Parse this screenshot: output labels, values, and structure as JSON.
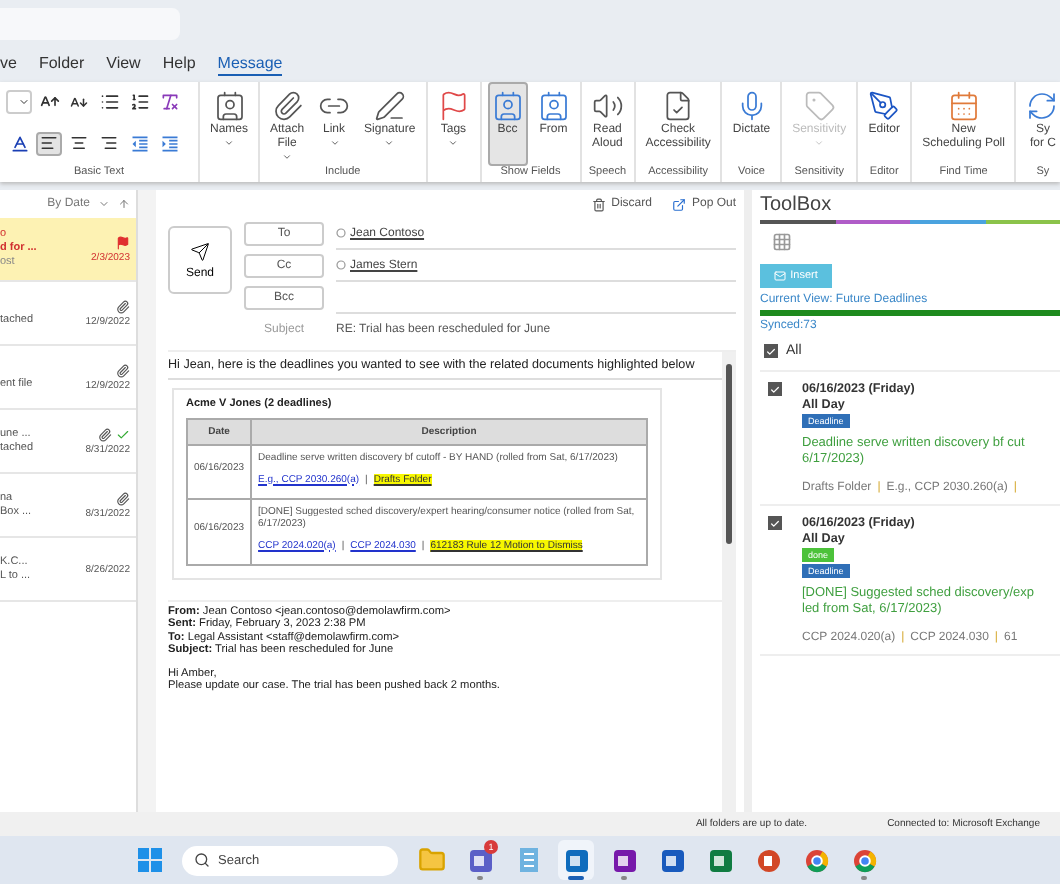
{
  "menu_tabs": [
    {
      "label": "ve",
      "selected": false
    },
    {
      "label": "Folder",
      "selected": false
    },
    {
      "label": "View",
      "selected": false
    },
    {
      "label": "Help",
      "selected": false
    },
    {
      "label": "Message",
      "selected": true
    }
  ],
  "ribbon": {
    "basic_text": {
      "label": "Basic Text",
      "alignment": [
        {
          "selected": true
        },
        {
          "selected": false
        },
        {
          "selected": false
        }
      ]
    },
    "groups": [
      {
        "items": [
          {
            "lines": [
              "Names"
            ],
            "dropdown": true,
            "selected": false,
            "disabled": false
          }
        ]
      },
      {
        "label": "Include",
        "items": [
          {
            "lines": [
              "Attach",
              "File"
            ],
            "dropdown": true,
            "selected": false,
            "disabled": false
          },
          {
            "lines": [
              "Link"
            ],
            "dropdown": true,
            "selected": false,
            "disabled": false
          },
          {
            "lines": [
              "Signature"
            ],
            "dropdown": true,
            "selected": false,
            "disabled": false
          }
        ]
      },
      {
        "items": [
          {
            "lines": [
              "Tags"
            ],
            "dropdown": true,
            "selected": false,
            "disabled": false
          }
        ]
      },
      {
        "label": "Show Fields",
        "items": [
          {
            "lines": [
              "Bcc"
            ],
            "dropdown": false,
            "selected": true,
            "disabled": false
          },
          {
            "lines": [
              "From"
            ],
            "dropdown": false,
            "selected": false,
            "disabled": false
          }
        ]
      },
      {
        "label": "Speech",
        "items": [
          {
            "lines": [
              "Read",
              "Aloud"
            ],
            "dropdown": false,
            "selected": false,
            "disabled": false
          }
        ]
      },
      {
        "label": "Accessibility",
        "items": [
          {
            "lines": [
              "Check",
              "Accessibility"
            ],
            "dropdown": false,
            "selected": false,
            "disabled": false
          }
        ]
      },
      {
        "label": "Voice",
        "items": [
          {
            "lines": [
              "Dictate"
            ],
            "dropdown": false,
            "selected": false,
            "disabled": false
          }
        ]
      },
      {
        "label": "Sensitivity",
        "items": [
          {
            "lines": [
              "Sensitivity"
            ],
            "dropdown": true,
            "selected": false,
            "disabled": true
          }
        ]
      },
      {
        "label": "Editor",
        "items": [
          {
            "lines": [
              "Editor"
            ],
            "dropdown": false,
            "selected": false,
            "disabled": false
          }
        ]
      },
      {
        "label": "Find Time",
        "items": [
          {
            "lines": [
              "New",
              "Scheduling Poll"
            ],
            "dropdown": false,
            "selected": false,
            "disabled": false
          }
        ]
      },
      {
        "label": "Sy",
        "items": [
          {
            "lines": [
              "Sy",
              "for C"
            ],
            "dropdown": false,
            "selected": false,
            "disabled": false
          }
        ]
      }
    ]
  },
  "message_list": {
    "sort": "By Date",
    "items": [
      {
        "lines": [
          "o",
          "d for ...",
          "ost"
        ],
        "date": "2/3/2023",
        "flagged": true,
        "attachment": false,
        "done": false
      },
      {
        "lines": [
          "tached"
        ],
        "date": "12/9/2022",
        "flagged": false,
        "attachment": true,
        "done": false
      },
      {
        "lines": [
          "ent file"
        ],
        "date": "12/9/2022",
        "flagged": false,
        "attachment": true,
        "done": false
      },
      {
        "lines": [
          "une ...",
          "tached"
        ],
        "date": "8/31/2022",
        "flagged": false,
        "attachment": true,
        "done": true
      },
      {
        "lines": [
          "na",
          "Box ..."
        ],
        "date": "8/31/2022",
        "flagged": false,
        "attachment": true,
        "done": false
      },
      {
        "lines": [
          "K.C...",
          "L to ..."
        ],
        "date": "8/26/2022",
        "flagged": false,
        "attachment": false,
        "done": false
      }
    ]
  },
  "compose": {
    "actions": [
      "Discard",
      "Pop Out"
    ],
    "send": "Send",
    "recipients": [
      {
        "button": "To",
        "names": [
          "Jean Contoso"
        ]
      },
      {
        "button": "Cc",
        "names": [
          "James Stern"
        ]
      },
      {
        "button": "Bcc"
      }
    ],
    "subject_label": "Subject",
    "subject": "RE: Trial has been rescheduled for June",
    "body": {
      "intro": "Hi Jean, here is the deadlines you wanted to see with the related documents highlighted below",
      "card": {
        "title": "Acme V Jones (2 deadlines)",
        "columns": [
          "Date",
          "Description"
        ],
        "rows": [
          {
            "date": "06/16/2023",
            "description": "Deadline serve written discovery bf cutoff - BY HAND (rolled from Sat, 6/17/2023)",
            "links": [
              {
                "text": "E.g., CCP 2030.260(a)",
                "highlighted": false
              },
              {
                "text": "Drafts Folder",
                "highlighted": true
              }
            ]
          },
          {
            "date": "06/16/2023",
            "description": "[DONE] Suggested sched discovery/expert hearing/consumer notice (rolled from Sat, 6/17/2023)",
            "links": [
              {
                "text": "CCP 2024.020(a)",
                "highlighted": false
              },
              {
                "text": "CCP 2024.030",
                "highlighted": false
              },
              {
                "text": "612183 Rule 12 Motion to Dismiss",
                "highlighted": true
              }
            ]
          }
        ]
      },
      "separator": "|",
      "quoted_headers": [
        "**From:** Jean Contoso <jean.contoso@demolawfirm.com>",
        "**Sent:** Friday, February 3, 2023 2:38 PM",
        "**To:** Legal Assistant <staff@demolawfirm.com>",
        "**Subject:** Trial has been rescheduled for June"
      ],
      "quoted_body": [
        "Hi Amber,",
        "Please update our case. The trial has been pushed back 2 months."
      ]
    }
  },
  "toolbox": {
    "title": "ToolBox",
    "insert": "Insert",
    "current_view": "Current View: Future Deadlines",
    "sync": {
      "level": 1
    },
    "synced": "Synced:73",
    "all": {
      "label": "All",
      "checked": true
    },
    "entries": [
      {
        "checked": true,
        "date": "06/16/2023 (Friday)",
        "time": "All Day",
        "badges": [
          {
            "text": "Deadline",
            "color": "#2f6fb7"
          }
        ],
        "lines": [
          "Deadline serve written discovery bf cut",
          "6/17/2023)"
        ],
        "links": [
          "Drafts Folder",
          "E.g., CCP 2030.260(a)"
        ],
        "trailing_separator": true
      },
      {
        "checked": true,
        "date": "06/16/2023 (Friday)",
        "time": "All Day",
        "badges": [
          {
            "text": "done",
            "color": "#4cc23a"
          },
          {
            "text": "Deadline",
            "color": "#2f6fb7"
          }
        ],
        "lines": [
          "[DONE] Suggested sched discovery/exp",
          "led from Sat, 6/17/2023)"
        ],
        "links": [
          "CCP 2024.020(a)",
          "CCP 2024.030",
          "61"
        ],
        "trailing_separator": false
      }
    ]
  },
  "status_bar": [
    "All folders are up to date.",
    "Connected to: Microsoft Exchange"
  ],
  "taskbar": {
    "search": "Search",
    "apps": [
      {
        "running": false,
        "active": false
      },
      {
        "badge": "1",
        "running": true,
        "active": false
      },
      {
        "running": false,
        "active": false
      },
      {
        "running": true,
        "active": true
      },
      {
        "running": true,
        "active": false
      },
      {
        "running": false,
        "active": false
      },
      {
        "running": false,
        "active": false
      },
      {
        "running": false,
        "active": false
      },
      {
        "running": false,
        "active": false
      },
      {
        "running": true,
        "active": false
      }
    ]
  }
}
